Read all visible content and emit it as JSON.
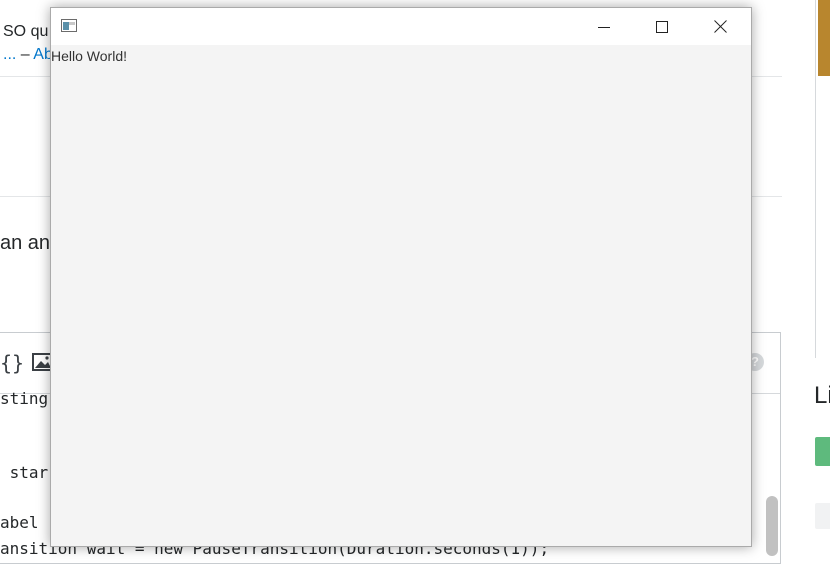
{
  "background": {
    "snippet_fragment": "SO qu",
    "link_dash": "–",
    "link_fragment": "Abr",
    "answer_fragment": "an an",
    "toolbar": {
      "braces_icon": "{}",
      "image_icon": "image-icon",
      "help_label": "?"
    },
    "code_lines": [
      "sting",
      " star",
      "abel",
      "ansition wait = new PauseTransition(Duration.seconds(1));"
    ],
    "aside_fragment": "Li",
    "colors": {
      "link": "#0077cc",
      "accent": "#b8862e",
      "green": "#5eba7d"
    }
  },
  "window": {
    "title": "",
    "controls": [
      "minimize-icon",
      "maximize-icon",
      "close-icon"
    ],
    "label": "Hello World!"
  }
}
